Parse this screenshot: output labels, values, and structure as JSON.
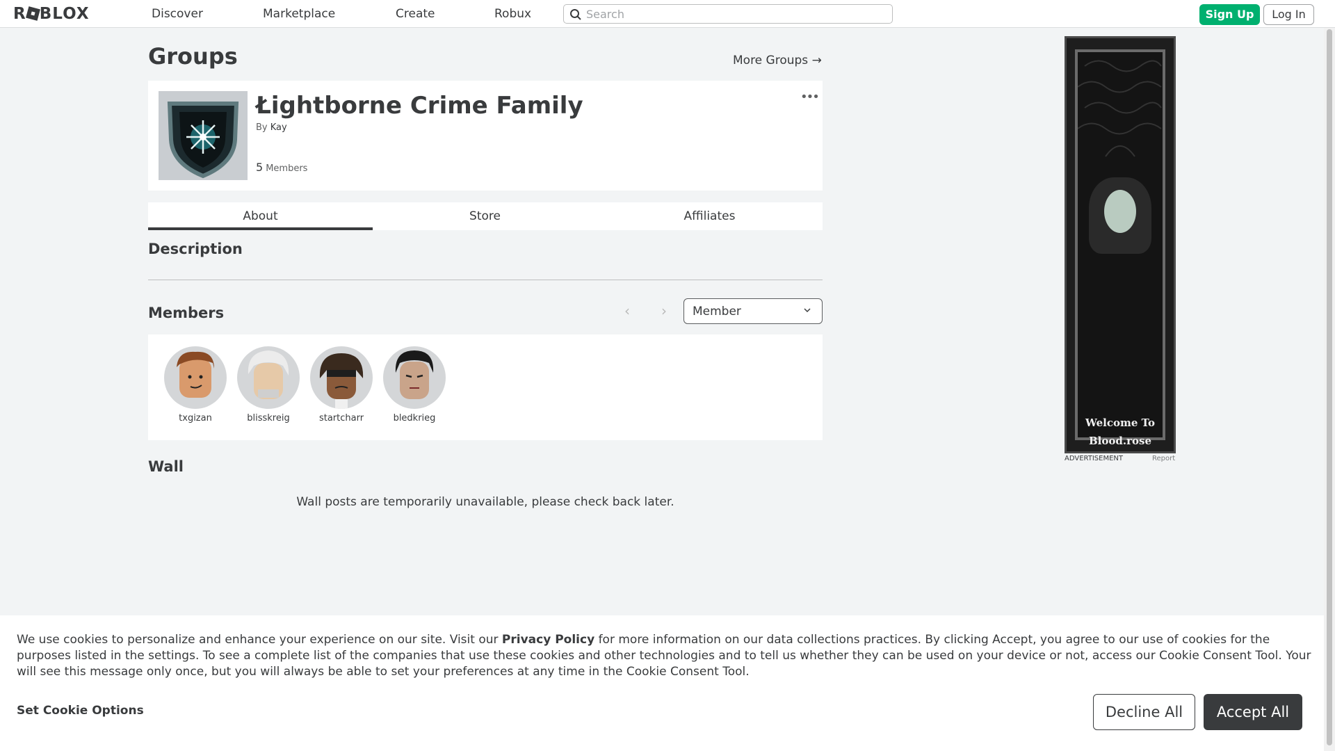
{
  "nav": {
    "logo": "ROBLOX",
    "links": [
      "Discover",
      "Marketplace",
      "Create",
      "Robux"
    ],
    "search_placeholder": "Search",
    "signup_label": "Sign Up",
    "login_label": "Log In"
  },
  "page": {
    "title": "Groups",
    "more_groups": "More Groups →"
  },
  "group": {
    "name": "Łightborne Crime Family",
    "by_prefix": "By",
    "owner": "Kay",
    "member_count": "5",
    "member_count_label": "Members",
    "menu_icon": "ellipsis-icon"
  },
  "tabs": [
    "About",
    "Store",
    "Affiliates"
  ],
  "active_tab": "About",
  "sections": {
    "description": "Description",
    "members": "Members",
    "wall": "Wall"
  },
  "members": {
    "role_selected": "Member",
    "list": [
      {
        "name": "txgizan",
        "skin": "#d99a6c",
        "hair": "#8a4a24"
      },
      {
        "name": "blisskreig",
        "skin": "#e6c9a8",
        "hair": "#e8e8e8"
      },
      {
        "name": "startcharr",
        "skin": "#8a5a3a",
        "hair": "#3a2a1e"
      },
      {
        "name": "bledkrieg",
        "skin": "#c9a48a",
        "hair": "#1a1a1a"
      }
    ]
  },
  "wall": {
    "message": "Wall posts are temporarily unavailable, please check back later."
  },
  "ad": {
    "text_line1": "Welcome To",
    "text_line2": "Blood.rose",
    "label": "ADVERTISEMENT",
    "report": "Report"
  },
  "cookie": {
    "text_before": "We use cookies to personalize and enhance your experience on our site. Visit our ",
    "link": "Privacy Policy",
    "text_after": " for more information on our data collections practices. By clicking Accept, you agree to our use of cookies for the purposes listed in the settings. To see a complete list of the companies that use these cookies and other technologies and to tell us whether they can be used on your device or not, access our Cookie Consent Tool. Your will see this message only once, but you will always be able to set your preferences at any time in the Cookie Consent Tool.",
    "options_label": "Set Cookie Options",
    "decline_label": "Decline All",
    "accept_label": "Accept All"
  },
  "colors": {
    "signup": "#00b06f",
    "text": "#393b3d",
    "background": "#f2f4f5"
  }
}
